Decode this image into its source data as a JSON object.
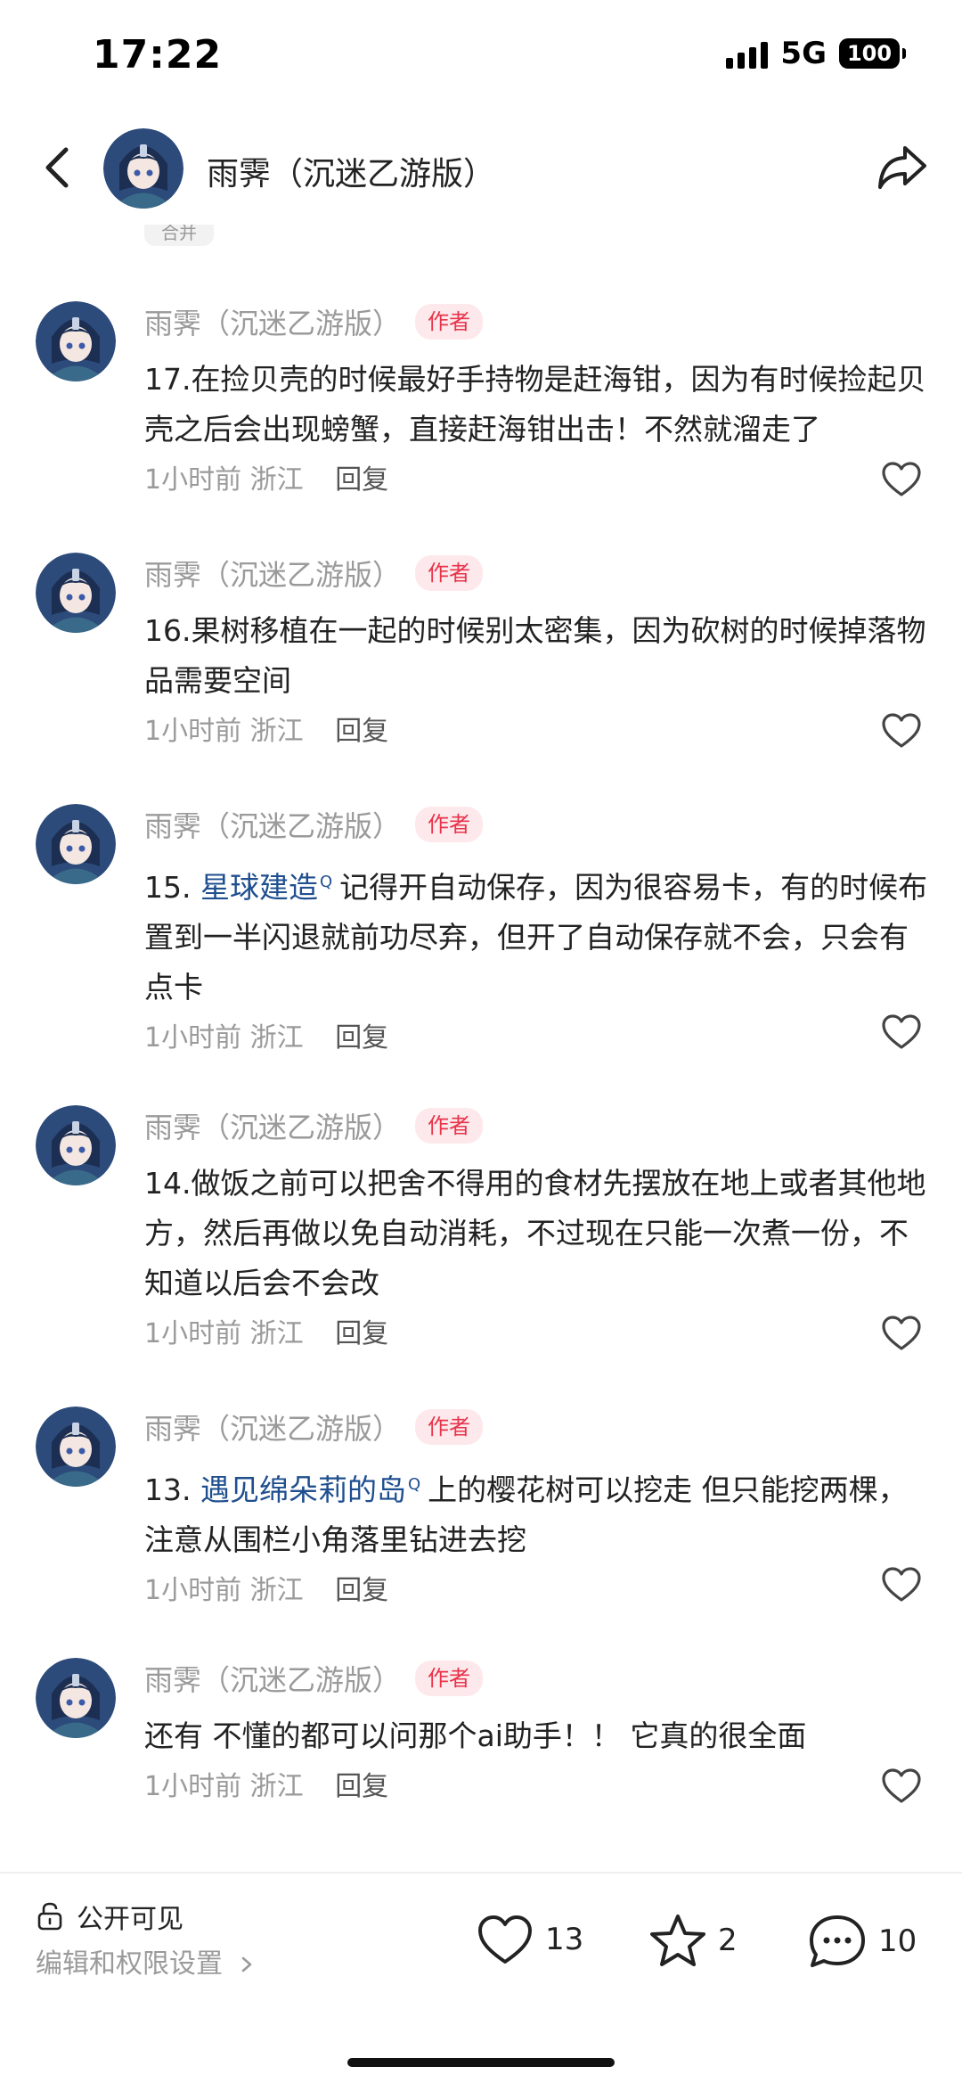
{
  "status_bar": {
    "time": "17:22",
    "network": "5G",
    "battery": "100"
  },
  "header": {
    "title": "雨霁（沉迷乙游版）"
  },
  "collapsed_label": "合并",
  "comments": [
    {
      "name": "雨霁（沉迷乙游版）",
      "badge": "作者",
      "text": "17.在捡贝壳的时候最好手持物是赶海钳，因为有时候捡起贝壳之后会出现螃蟹，直接赶海钳出击！不然就溜走了",
      "time": "1小时前",
      "location": "浙江",
      "reply": "回复"
    },
    {
      "name": "雨霁（沉迷乙游版）",
      "badge": "作者",
      "text": "16.果树移植在一起的时候别太密集，因为砍树的时候掉落物品需要空间",
      "time": "1小时前",
      "location": "浙江",
      "reply": "回复"
    },
    {
      "name": "雨霁（沉迷乙游版）",
      "badge": "作者",
      "prefix": "15. ",
      "link": "星球建造",
      "text": "记得开自动保存，因为很容易卡，有的时候布置到一半闪退就前功尽弃，但开了自动保存就不会，只会有点卡",
      "time": "1小时前",
      "location": "浙江",
      "reply": "回复"
    },
    {
      "name": "雨霁（沉迷乙游版）",
      "badge": "作者",
      "text": "14.做饭之前可以把舍不得用的食材先摆放在地上或者其他地方，然后再做以免自动消耗，不过现在只能一次煮一份，不知道以后会不会改",
      "time": "1小时前",
      "location": "浙江",
      "reply": "回复"
    },
    {
      "name": "雨霁（沉迷乙游版）",
      "badge": "作者",
      "prefix": "13. ",
      "link": "遇见绵朵莉的岛",
      "text": "上的樱花树可以挖走 但只能挖两棵，注意从围栏小角落里钻进去挖",
      "time": "1小时前",
      "location": "浙江",
      "reply": "回复"
    },
    {
      "name": "雨霁（沉迷乙游版）",
      "badge": "作者",
      "text": "还有 不懂的都可以问那个ai助手！！ 它真的很全面",
      "time": "1小时前",
      "location": "浙江",
      "reply": "回复"
    }
  ],
  "bottom_bar": {
    "visibility": "公开可见",
    "permission": "编辑和权限设置",
    "likes": "13",
    "favorites": "2",
    "comments": "10"
  },
  "colors": {
    "author_badge_text": "#e8334a",
    "author_badge_bg": "#fde9ec",
    "link": "#1f4f8f"
  },
  "icons": [
    "back-icon",
    "share-icon",
    "heart-icon",
    "lock-icon",
    "chevron-right-icon",
    "star-icon",
    "comment-bubble-icon"
  ]
}
